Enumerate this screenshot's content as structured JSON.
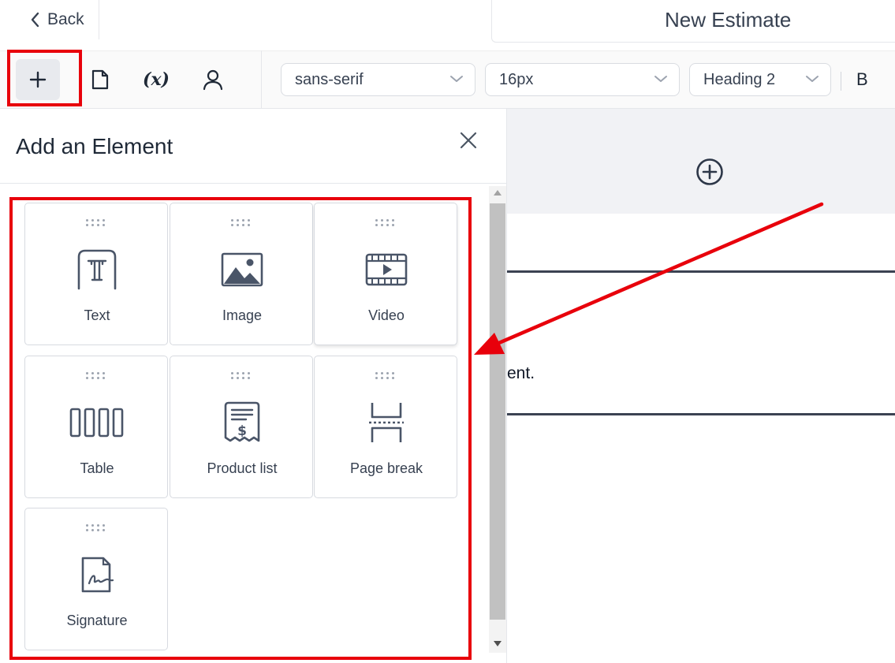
{
  "header": {
    "back_label": "Back",
    "title": "New Estimate"
  },
  "toolbar": {
    "tools": [
      {
        "icon": "plus-icon",
        "active": true
      },
      {
        "icon": "document-icon",
        "active": false
      },
      {
        "icon": "variable-icon",
        "label": "(x)",
        "active": false
      },
      {
        "icon": "user-icon",
        "active": false
      }
    ],
    "font_family": "sans-serif",
    "font_size": "16px",
    "block_style": "Heading 2",
    "bold_label": "B"
  },
  "panel": {
    "title": "Add an Element",
    "elements": [
      {
        "label": "Text",
        "icon": "text-icon"
      },
      {
        "label": "Image",
        "icon": "image-icon"
      },
      {
        "label": "Video",
        "icon": "video-icon"
      },
      {
        "label": "Table",
        "icon": "table-icon"
      },
      {
        "label": "Product list",
        "icon": "receipt-icon"
      },
      {
        "label": "Page break",
        "icon": "page-break-icon"
      },
      {
        "label": "Signature",
        "icon": "signature-icon"
      }
    ]
  },
  "document": {
    "visible_text": "ent."
  },
  "annotations": {
    "highlight_color": "#e8000b"
  }
}
